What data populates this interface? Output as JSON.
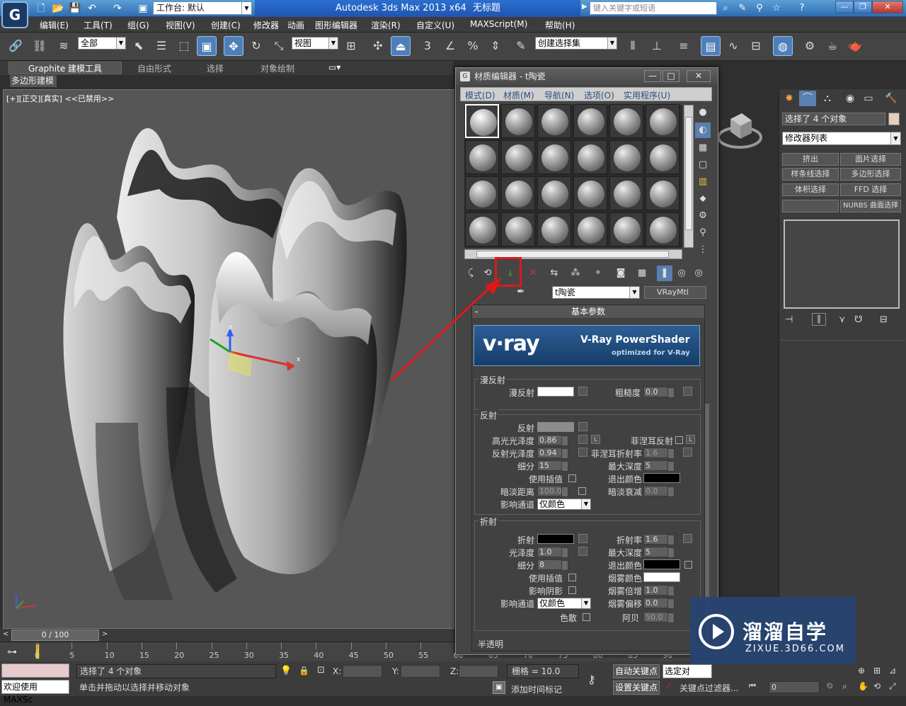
{
  "title_bar": {
    "app_title": "Autodesk 3ds Max  2013 x64",
    "doc_title": "无标题",
    "workspace": "工作台: 默认",
    "search_placeholder": "键入关键字或短语"
  },
  "menu": [
    "编辑(E)",
    "工具(T)",
    "组(G)",
    "视图(V)",
    "创建(C)",
    "修改器",
    "动画",
    "图形编辑器",
    "渲染(R)",
    "自定义(U)",
    "MAXScript(M)",
    "帮助(H)"
  ],
  "toolbar": {
    "selection_filter": "全部",
    "ref_coord": "视图",
    "named_selection": "创建选择集",
    "snap_label": "3",
    "pct_label": "%"
  },
  "ribbon": {
    "tabs": [
      "Graphite 建模工具",
      "自由形式",
      "选择",
      "对象绘制"
    ],
    "sub_tab": "多边形建模"
  },
  "viewport": {
    "label": "[+][正交][真实] <<已禁用>>",
    "axis_labels": {
      "z": "z",
      "x": "x"
    }
  },
  "time": {
    "slider": "0 / 100",
    "ticks": [
      "0",
      "5",
      "10",
      "15",
      "20",
      "25",
      "30",
      "35",
      "40",
      "45",
      "50",
      "55",
      "60",
      "65",
      "70",
      "75",
      "80",
      "85",
      "90"
    ]
  },
  "status": {
    "welcome": "欢迎使用 MAXSc",
    "selected": "选择了 4 个对象",
    "prompt": "单击并拖动以选择并移动对象",
    "x_label": "X:",
    "y_label": "Y:",
    "z_label": "Z:",
    "grid": "栅格 = 10.0",
    "add_time_tag": "添加时间标记",
    "auto_key": "自动关键点",
    "set_key": "设置关键点",
    "selected_btn": "选定对",
    "key_filter": "关键点过滤器...",
    "frame": "0"
  },
  "material_editor": {
    "title": "材质编辑器 - t陶瓷",
    "menu": [
      "模式(D)",
      "材质(M)",
      "导航(N)",
      "选项(O)",
      "实用程序(U)"
    ],
    "material_name": "t陶瓷",
    "material_type": "VRayMtl",
    "rollout_title": "基本参数",
    "vray_logo": {
      "brand": "v·ray",
      "product": "V-Ray PowerShader",
      "tagline": "optimized for V-Ray"
    },
    "diffuse": {
      "group": "漫反射",
      "diffuse_label": "漫反射",
      "roughness_label": "粗糙度",
      "roughness": "0.0"
    },
    "reflection": {
      "group": "反射",
      "reflect_label": "反射",
      "hilight_gloss_label": "高光光泽度",
      "hilight_gloss": "0.86",
      "refl_gloss_label": "反射光泽度",
      "refl_gloss": "0.94",
      "subdivs_label": "细分",
      "subdivs": "15",
      "use_interp_label": "使用插值",
      "dim_dist_label": "暗淡距离",
      "dim_dist": "100.0",
      "affect_channels_label": "影响通道",
      "affect_channels": "仅颜色",
      "fresnel_label": "菲涅耳反射",
      "fresnel_ior_label": "菲涅耳折射率",
      "fresnel_ior": "1.6",
      "max_depth_label": "最大深度",
      "max_depth": "5",
      "exit_color_label": "退出颜色",
      "dim_falloff_label": "暗淡衰减",
      "dim_falloff": "0.0",
      "lock": "L"
    },
    "refraction": {
      "group": "折射",
      "refract_label": "折射",
      "gloss_label": "光泽度",
      "gloss": "1.0",
      "subdivs_label": "细分",
      "subdivs": "8",
      "use_interp_label": "使用插值",
      "affect_shadows_label": "影响阴影",
      "affect_channels_label": "影响通道",
      "affect_channels": "仅颜色",
      "ior_label": "折射率",
      "ior": "1.6",
      "max_depth_label": "最大深度",
      "max_depth": "5",
      "exit_color_label": "退出颜色",
      "fog_color_label": "烟雾颜色",
      "fog_mult_label": "烟雾倍增",
      "fog_mult": "1.0",
      "fog_bias_label": "烟雾偏移",
      "fog_bias": "0.0",
      "dispersion_label": "色散",
      "abbe_label": "阿贝",
      "abbe": "50.0"
    },
    "translucency_group": "半透明"
  },
  "command_panel": {
    "selection_info": "选择了 4 个对象",
    "modifier_list": "修改器列表",
    "buttons": [
      "挤出",
      "面片选择",
      "样条线选择",
      "多边形选择",
      "体积选择",
      "FFD 选择",
      "",
      "NURBS 曲面选择"
    ]
  },
  "watermark": {
    "brand": "溜溜自学",
    "url": "ZIXUE.3D66.COM"
  },
  "colors": {
    "highlight": "#e01818",
    "accent": "#2b6fd1"
  }
}
